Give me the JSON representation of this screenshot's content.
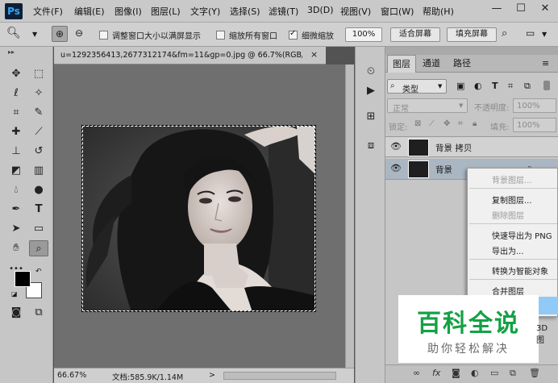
{
  "app": {
    "logo": "Ps"
  },
  "menu": [
    "文件(F)",
    "编辑(E)",
    "图像(I)",
    "图层(L)",
    "文字(Y)",
    "选择(S)",
    "滤镜(T)",
    "3D(D)",
    "视图(V)",
    "窗口(W)",
    "帮助(H)"
  ],
  "window_controls": {
    "minimize": "—",
    "maximize": "☐",
    "close": "✕"
  },
  "options": {
    "resize_windows": "调整窗口大小以满屏显示",
    "resize_checked": false,
    "zoom_all": "缩放所有窗口",
    "zoom_all_checked": false,
    "scrubby": "细微缩放",
    "scrubby_checked": true,
    "zoom_value": "100%",
    "fit_screen": "适合屏幕",
    "fill_screen": "填充屏幕"
  },
  "document": {
    "tab_title": "u=1292356413,2677312174&fm=11&gp=0.jpg @ 66.7%(RGB/...",
    "close": "×"
  },
  "status": {
    "zoom": "66.67%",
    "doc_size": "文档:585.9K/1.14M",
    "arrow": ">"
  },
  "layers_panel": {
    "tabs": [
      "图层",
      "通道",
      "路径"
    ],
    "filter_label": "类型",
    "blend_mode": "正常",
    "opacity_label": "不透明度:",
    "opacity_value": "100%",
    "lock_label": "锁定:",
    "fill_label": "填充:",
    "fill_value": "100%",
    "layers": [
      {
        "name": "背景 拷贝"
      },
      {
        "name": "背景"
      }
    ]
  },
  "context_menu": {
    "items": [
      {
        "label": "背景图层...",
        "disabled": true
      },
      {
        "label": "复制图层...",
        "disabled": false
      },
      {
        "label": "删除图层",
        "disabled": true
      },
      {
        "label": "快速导出为 PNG",
        "disabled": false
      },
      {
        "label": "导出为...",
        "disabled": false
      },
      {
        "label": "转换为智能对象",
        "disabled": false
      },
      {
        "label": "合并图层",
        "disabled": false
      }
    ],
    "partial_label": "3D 图"
  },
  "watermark": {
    "main": "百科全说",
    "sub": "助你轻松解决"
  },
  "colors": {
    "accent": "#31a8ff",
    "highlight": "#91c9f7",
    "watermark_green": "#14a145"
  }
}
